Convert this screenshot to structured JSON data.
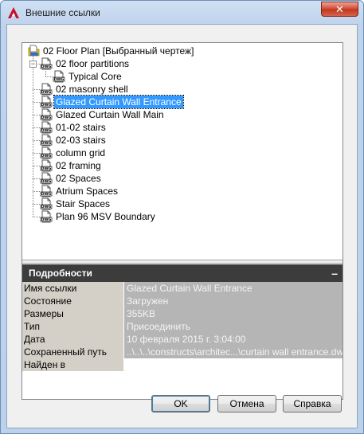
{
  "window": {
    "title": "Внешние ссылки",
    "close_label": "✕"
  },
  "tree": {
    "root": {
      "label": "02 Floor Plan [Выбранный чертеж]",
      "icon": "drawing-folder-icon"
    },
    "items": [
      {
        "label": "02 floor partitions",
        "icon": "dwg-file-icon",
        "expanded": true
      },
      {
        "label": "Typical Core",
        "icon": "dwg-file-icon",
        "child": true
      },
      {
        "label": "02 masonry shell",
        "icon": "dwg-file-icon"
      },
      {
        "label": "Glazed Curtain Wall Entrance",
        "icon": "dwg-file-icon",
        "selected": true
      },
      {
        "label": "Glazed Curtain Wall Main",
        "icon": "dwg-file-icon"
      },
      {
        "label": "01-02 stairs",
        "icon": "dwg-file-icon"
      },
      {
        "label": "02-03 stairs",
        "icon": "dwg-file-icon"
      },
      {
        "label": "column grid",
        "icon": "dwg-file-icon"
      },
      {
        "label": "02 framing",
        "icon": "dwg-file-icon"
      },
      {
        "label": "02 Spaces",
        "icon": "dwg-file-icon"
      },
      {
        "label": "Atrium Spaces",
        "icon": "dwg-file-icon"
      },
      {
        "label": "Stair Spaces",
        "icon": "dwg-file-icon"
      },
      {
        "label": "Plan 96 MSV Boundary",
        "icon": "dwg-file-icon"
      }
    ]
  },
  "details": {
    "title": "Подробности",
    "collapse_label": "–",
    "rows": [
      {
        "name": "Имя ссылки",
        "value": "Glazed Curtain Wall Entrance"
      },
      {
        "name": "Состояние",
        "value": "Загружен"
      },
      {
        "name": "Размеры",
        "value": "355KB"
      },
      {
        "name": "Тип",
        "value": "Присоединить"
      },
      {
        "name": "Дата",
        "value": "10 февраля 2015 г.  3:04:00"
      },
      {
        "name": "Сохраненный путь",
        "value": "..\\..\\..\\constructs\\architec...\\curtain wall entrance.dwg"
      },
      {
        "name": "Найден в",
        "value": ""
      }
    ]
  },
  "buttons": {
    "ok": "OK",
    "cancel": "Отмена",
    "help": "Справка"
  },
  "colors": {
    "selection": "#3399ff",
    "details_header": "#3c3c3c",
    "close_button": "#c8402a"
  }
}
